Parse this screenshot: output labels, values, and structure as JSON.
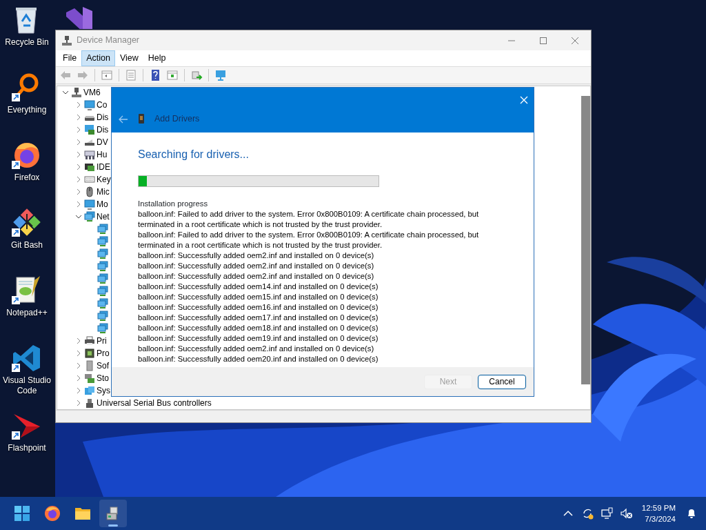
{
  "desktop_icons": [
    {
      "kind": "recycle",
      "label": "Recycle Bin",
      "shortcut": false
    },
    {
      "kind": "everything",
      "label": "Everything",
      "shortcut": true
    },
    {
      "kind": "firefox",
      "label": "Firefox",
      "shortcut": true
    },
    {
      "kind": "gitbash",
      "label": "Git Bash",
      "shortcut": true
    },
    {
      "kind": "notepadpp",
      "label": "Notepad++",
      "shortcut": true
    },
    {
      "kind": "vscode",
      "label": "Visual Studio Code",
      "shortcut": true
    },
    {
      "kind": "flashpoint",
      "label": "Flashpoint",
      "shortcut": true
    }
  ],
  "desktop_icons_column_2": [
    {
      "kind": "visualstudio"
    }
  ],
  "device_manager": {
    "title": "Device Manager",
    "menu": [
      {
        "label": "File",
        "selected": false
      },
      {
        "label": "Action",
        "selected": true
      },
      {
        "label": "View",
        "selected": false
      },
      {
        "label": "Help",
        "selected": false
      }
    ],
    "tree": {
      "label": "VM6",
      "kind": "computer",
      "expanded": true,
      "children": [
        {
          "label": "Co",
          "kind": "monitor",
          "expanded": false
        },
        {
          "label": "Dis",
          "kind": "disk",
          "expanded": false
        },
        {
          "label": "Dis",
          "kind": "display",
          "expanded": false
        },
        {
          "label": "DV",
          "kind": "dvd",
          "expanded": false
        },
        {
          "label": "Hu",
          "kind": "hid",
          "expanded": false
        },
        {
          "label": "IDE",
          "kind": "ide",
          "expanded": false
        },
        {
          "label": "Key",
          "kind": "keyboard",
          "expanded": false
        },
        {
          "label": "Mic",
          "kind": "mouse",
          "expanded": false
        },
        {
          "label": "Mo",
          "kind": "monitor",
          "expanded": false
        },
        {
          "label": "Net",
          "kind": "network",
          "expanded": true,
          "children": [
            {
              "kind": "network"
            },
            {
              "kind": "network"
            },
            {
              "kind": "network"
            },
            {
              "kind": "network"
            },
            {
              "kind": "network"
            },
            {
              "kind": "network"
            },
            {
              "kind": "network"
            },
            {
              "kind": "network"
            },
            {
              "kind": "network"
            }
          ]
        },
        {
          "label": "Pri",
          "kind": "printer",
          "expanded": false
        },
        {
          "label": "Pro",
          "kind": "processor",
          "expanded": false
        },
        {
          "label": "Sof",
          "kind": "software",
          "expanded": false
        },
        {
          "label": "Sto",
          "kind": "storage",
          "expanded": false
        },
        {
          "label": "Sys",
          "kind": "system",
          "expanded": false
        },
        {
          "label": "Universal Serial Bus controllers",
          "kind": "usb",
          "expanded": false
        }
      ]
    }
  },
  "dialog": {
    "title": "Add Drivers",
    "heading": "Searching for drivers...",
    "progress": {
      "level": 0.035
    },
    "log_label": "Installation progress",
    "log": [
      "balloon.inf: Failed to add driver to the system. Error 0x800B0109: A certificate chain processed, but terminated in a root certificate which is not trusted by the trust provider.",
      "balloon.inf: Failed to add driver to the system. Error 0x800B0109: A certificate chain processed, but terminated in a root certificate which is not trusted by the trust provider.",
      "balloon.inf: Successfully added oem2.inf and installed on 0 device(s)",
      "balloon.inf: Successfully added oem2.inf and installed on 0 device(s)",
      "balloon.inf: Successfully added oem2.inf and installed on 0 device(s)",
      "balloon.inf: Successfully added oem14.inf and installed on 0 device(s)",
      "balloon.inf: Successfully added oem15.inf and installed on 0 device(s)",
      "balloon.inf: Successfully added oem16.inf and installed on 0 device(s)",
      "balloon.inf: Successfully added oem17.inf and installed on 0 device(s)",
      "balloon.inf: Successfully added oem18.inf and installed on 0 device(s)",
      "balloon.inf: Successfully added oem19.inf and installed on 0 device(s)",
      "balloon.inf: Successfully added oem2.inf and installed on 0 device(s)",
      "balloon.inf: Successfully added oem20.inf and installed on 0 device(s)"
    ],
    "buttons": [
      {
        "label": "Next",
        "disabled": true
      },
      {
        "label": "Cancel",
        "disabled": false
      }
    ]
  },
  "taskbar": {
    "apps": [
      {
        "kind": "start",
        "selected": false
      },
      {
        "kind": "firefox",
        "selected": false
      },
      {
        "kind": "explorer",
        "selected": false
      },
      {
        "kind": "devicemanager",
        "selected": true
      }
    ],
    "time": "12:59 PM",
    "date": "7/3/2024"
  }
}
